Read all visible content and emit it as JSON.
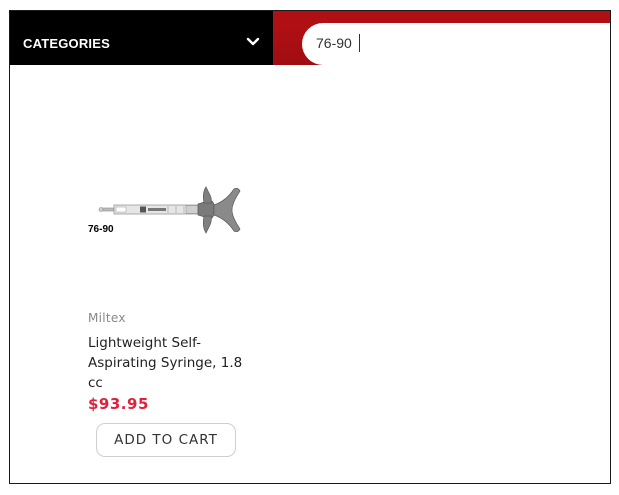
{
  "header": {
    "categories_label": "CATEGORIES",
    "search_value": "76-90"
  },
  "product": {
    "image_sku_label": "76-90",
    "brand": "Miltex",
    "title": "Lightweight Self-Aspirating Syringe, 1.8 cc",
    "price": "$93.95",
    "add_to_cart_label": "ADD TO CART"
  },
  "colors": {
    "header_black": "#000000",
    "header_red": "#b01014",
    "price_red": "#e0203c"
  }
}
